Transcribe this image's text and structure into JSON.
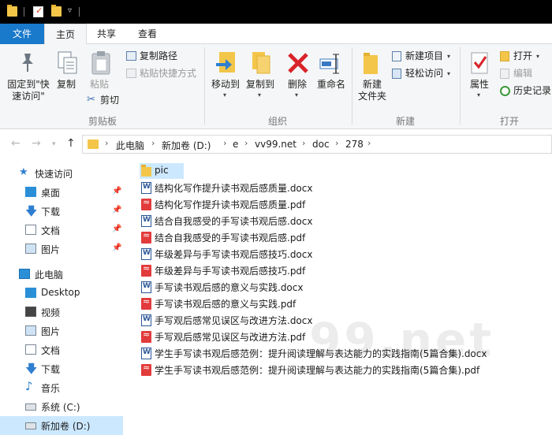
{
  "ribbon_tabs": {
    "file": "文件",
    "home": "主页",
    "share": "共享",
    "view": "查看"
  },
  "clipboard": {
    "pin_quick_access": "固定到\"快速访问\"",
    "copy": "复制",
    "paste": "粘贴",
    "copy_path": "复制路径",
    "paste_shortcut": "粘贴快捷方式",
    "cut": "剪切",
    "group": "剪贴板"
  },
  "organize": {
    "move_to": "移动到",
    "copy_to": "复制到",
    "delete": "删除",
    "rename": "重命名",
    "group": "组织"
  },
  "new": {
    "new_folder": "新建\n文件夹",
    "new_item": "新建项目",
    "easy_access": "轻松访问",
    "group": "新建"
  },
  "open": {
    "properties": "属性",
    "open": "打开",
    "edit": "编辑",
    "history": "历史记录",
    "group": "打开"
  },
  "breadcrumb": [
    "此电脑",
    "新加卷 (D:)",
    "e",
    "vv99.net",
    "doc",
    "278"
  ],
  "nav": {
    "quick_access": "快速访问",
    "quick_items": [
      "桌面",
      "下载",
      "文档",
      "图片"
    ],
    "this_pc": "此电脑",
    "pc_items": [
      "Desktop",
      "视频",
      "图片",
      "文档",
      "下载",
      "音乐",
      "系统 (C:)",
      "新加卷 (D:)"
    ]
  },
  "files": [
    {
      "name": "pic",
      "type": "folder"
    },
    {
      "name": "结构化写作提升读书观后感质量.docx",
      "type": "docx"
    },
    {
      "name": "结构化写作提升读书观后感质量.pdf",
      "type": "pdf"
    },
    {
      "name": "结合自我感受的手写读书观后感.docx",
      "type": "docx"
    },
    {
      "name": "结合自我感受的手写读书观后感.pdf",
      "type": "pdf"
    },
    {
      "name": "年级差异与手写读书观后感技巧.docx",
      "type": "docx"
    },
    {
      "name": "年级差异与手写读书观后感技巧.pdf",
      "type": "pdf"
    },
    {
      "name": "手写读书观后感的意义与实践.docx",
      "type": "docx"
    },
    {
      "name": "手写读书观后感的意义与实践.pdf",
      "type": "pdf"
    },
    {
      "name": "手写观后感常见误区与改进方法.docx",
      "type": "docx"
    },
    {
      "name": "手写观后感常见误区与改进方法.pdf",
      "type": "pdf"
    },
    {
      "name": "学生手写读书观后感范例：提升阅读理解与表达能力的实践指南(5篇合集).docx",
      "type": "docx"
    },
    {
      "name": "学生手写读书观后感范例：提升阅读理解与表达能力的实践指南(5篇合集).pdf",
      "type": "pdf"
    }
  ],
  "watermark": "99.net"
}
